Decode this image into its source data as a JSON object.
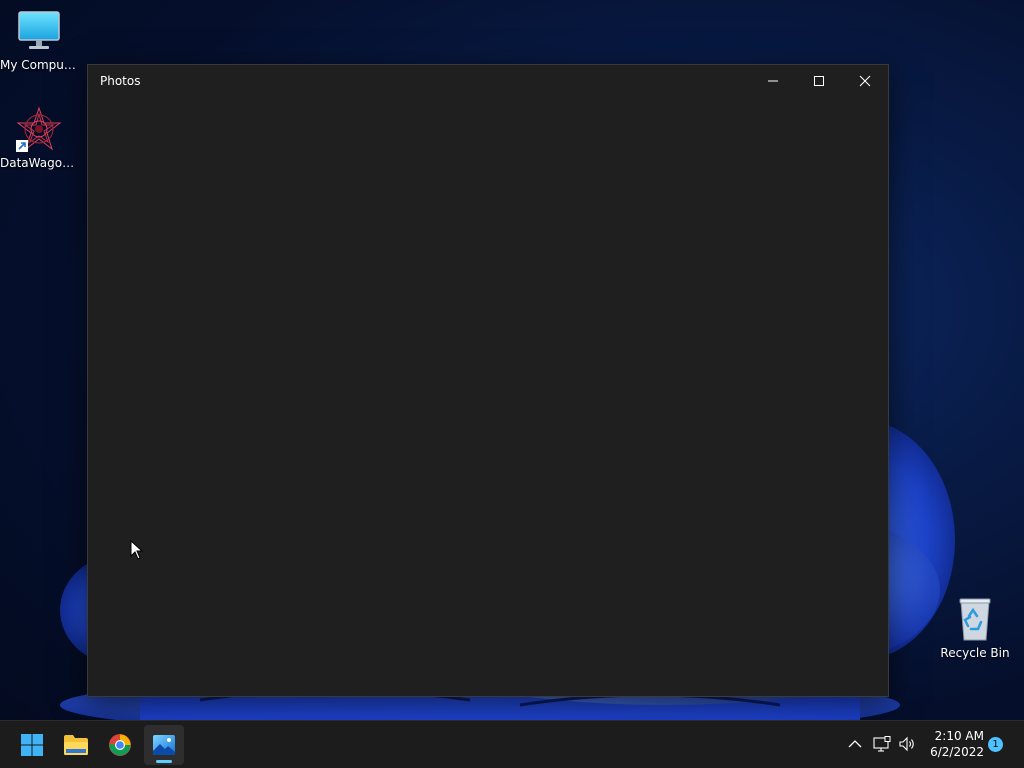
{
  "desktop": {
    "icons": [
      {
        "label": "My Computer",
        "icon": "monitor-icon"
      },
      {
        "label": "DataWagon...",
        "icon": "datawagon-app-icon"
      },
      {
        "label": "Recycle Bin",
        "icon": "recycle-bin-icon"
      }
    ]
  },
  "window": {
    "title": "Photos",
    "controls": {
      "minimize": "minimize-icon",
      "maximize": "maximize-icon",
      "close": "close-icon"
    }
  },
  "taskbar": {
    "apps": [
      {
        "name": "Start",
        "icon": "windows-start-icon",
        "active": false
      },
      {
        "name": "File Explorer",
        "icon": "folder-icon",
        "active": false
      },
      {
        "name": "Google Chrome",
        "icon": "chrome-icon",
        "active": false
      },
      {
        "name": "Photos",
        "icon": "photos-icon",
        "active": true
      }
    ],
    "tray": {
      "icons": [
        "chevron-up-icon",
        "network-icon",
        "volume-icon"
      ],
      "time": "2:10 AM",
      "date": "6/2/2022",
      "notification_count": "1"
    }
  },
  "colors": {
    "accent": "#60cdff",
    "window_bg": "#1f1f1f",
    "taskbar_bg": "#1c1c1c"
  }
}
